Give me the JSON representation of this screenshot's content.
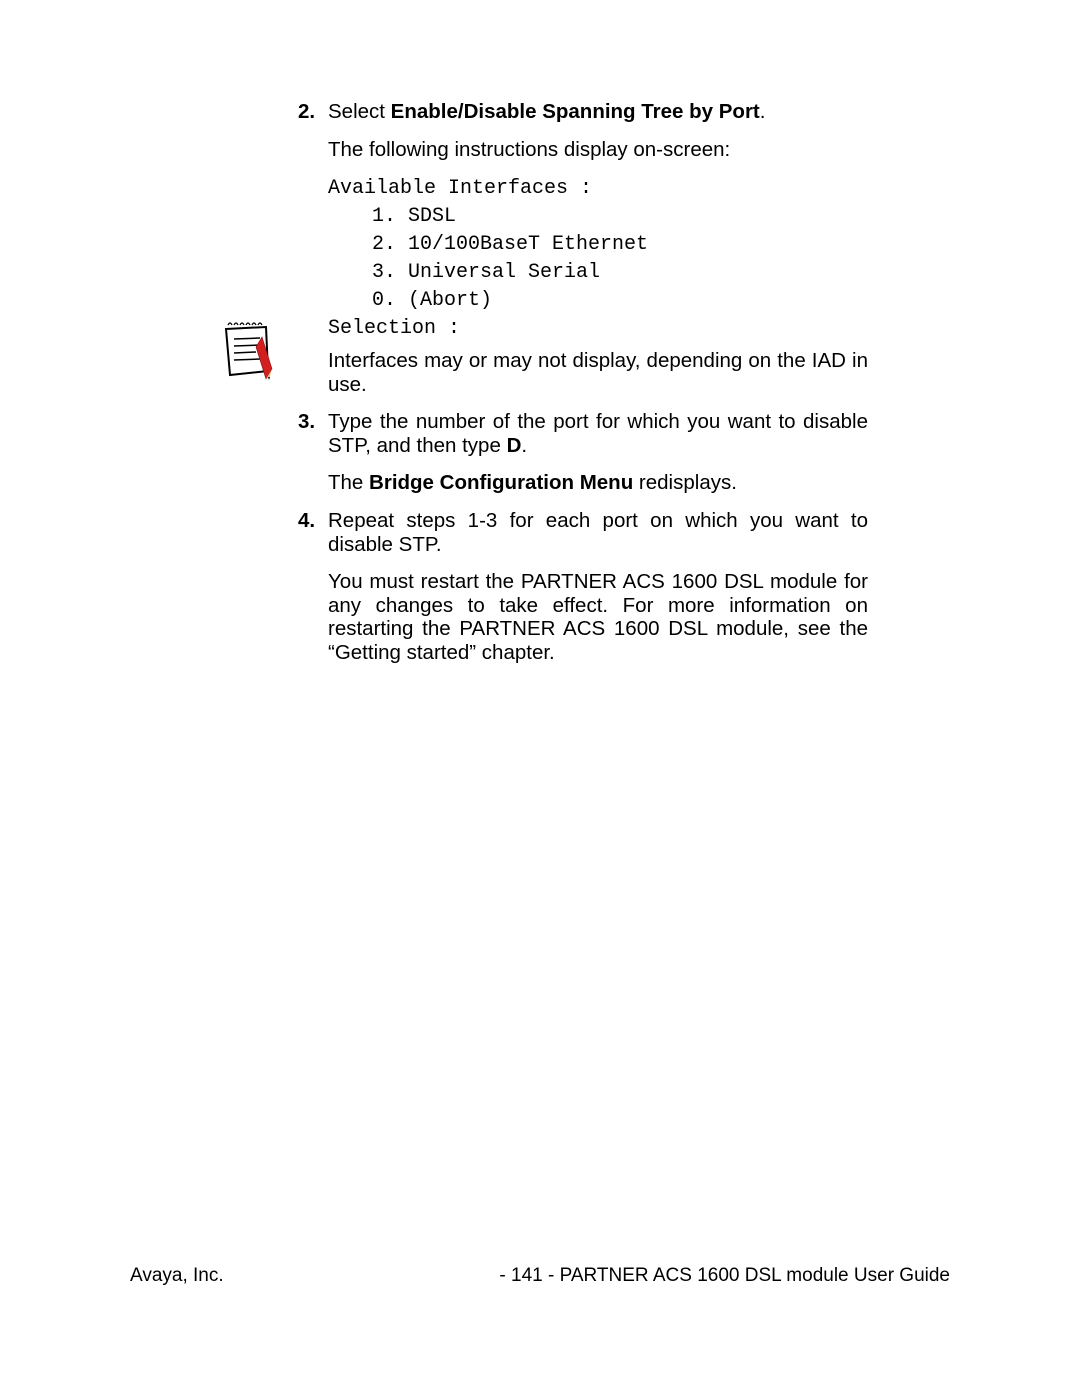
{
  "step2": {
    "num": "2.",
    "prefix": "Select ",
    "bold": "Enable/Disable Spanning Tree by Port",
    "suffix": ".",
    "follow": "The following instructions display on-screen:"
  },
  "terminal": {
    "header": "Available Interfaces :",
    "lines": [
      "1. SDSL",
      "2. 10/100BaseT Ethernet",
      "3. Universal Serial",
      "0. (Abort)"
    ],
    "prompt": "Selection :"
  },
  "note": "Interfaces may or may not display, depending on the IAD in use.",
  "step3": {
    "num": "3.",
    "line1_a": "Type the number of the port for which you want to disable STP, and then type ",
    "line1_b": "D",
    "line1_c": ".",
    "line2_a": "The ",
    "line2_b": "Bridge Configuration Menu",
    "line2_c": " redisplays."
  },
  "step4": {
    "num": "4.",
    "line1": "Repeat steps 1-3 for each port on which you want to disable STP.",
    "line2": "You must restart the PARTNER ACS 1600 DSL module for any changes to take effect.  For more information on restarting the PARTNER ACS 1600 DSL module, see the “Getting started” chapter."
  },
  "footer": {
    "left": "Avaya, Inc.",
    "right": "- 141 - PARTNER ACS 1600 DSL module User Guide"
  }
}
